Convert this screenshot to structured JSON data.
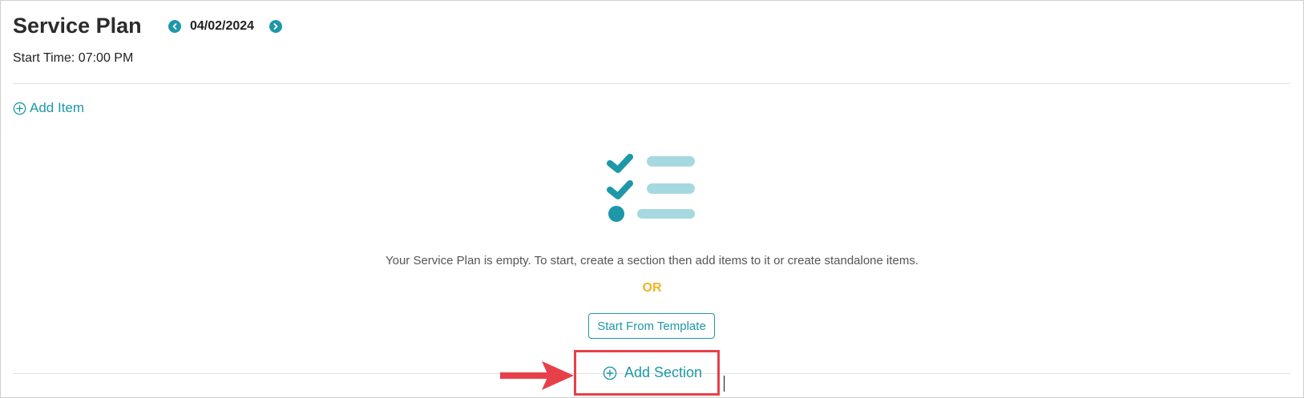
{
  "header": {
    "title": "Service Plan",
    "date": "04/02/2024",
    "start_time": "Start Time: 07:00 PM"
  },
  "toolbar": {
    "add_item_label": "Add Item"
  },
  "empty_state": {
    "message": "Your Service Plan is empty. To start, create a section then add items to it or create standalone items.",
    "or_label": "OR",
    "template_button_label": "Start From Template",
    "add_section_label": "Add Section"
  },
  "colors": {
    "accent": "#1e98a8",
    "accent_light": "#a6d9df",
    "or": "#f0b41e",
    "highlight": "#e8404a"
  },
  "icons": {
    "prev": "chevron-left-icon",
    "next": "chevron-right-icon",
    "add": "circle-plus-icon",
    "empty": "checklist-icon",
    "annotation": "arrow-right-icon"
  }
}
